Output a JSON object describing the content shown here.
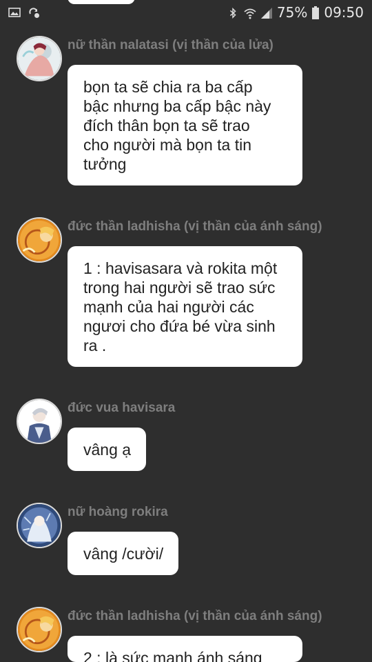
{
  "status_bar": {
    "left_icons": [
      "gallery-icon",
      "sync-icon"
    ],
    "right_icons": [
      "bluetooth-icon",
      "wifi-icon",
      "signal-icon",
      "battery-icon"
    ],
    "battery_percent": "75%",
    "time": "09:50"
  },
  "messages": [
    {
      "sender": "nữ thần nalatasi (vị thần của lửa)",
      "text": "bọn ta sẽ chia ra ba cấp\nbậc nhưng ba cấp bậc này\nđích thân bọn ta sẽ trao\ncho người mà bọn ta tin\ntưởng"
    },
    {
      "sender": "đức thần ladhisha (vị thần của ánh sáng)",
      "text": "1 : havisasara và rokita một\ntrong hai người sẽ trao sức\nmạnh của hai người các\nngươi cho đứa bé vừa sinh\nra ."
    },
    {
      "sender": "đức vua havisara",
      "text": "vâng ạ"
    },
    {
      "sender": "nữ hoàng rokira",
      "text": "vâng /cười/"
    },
    {
      "sender": "đức thần ladhisha (vị thần của ánh sáng)",
      "text": "2 : là sức mạnh ánh sáng"
    }
  ],
  "colors": {
    "background": "#2e2e2e",
    "bubble": "#ffffff",
    "sender_text": "#7e7e7e"
  }
}
